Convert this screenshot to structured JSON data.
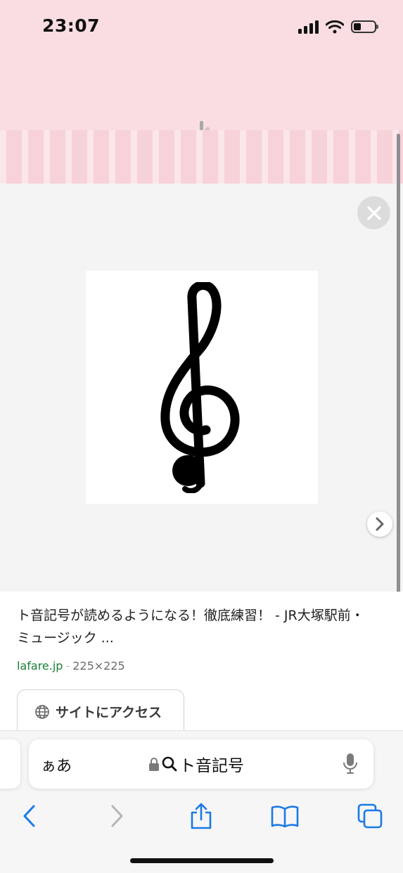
{
  "status_bar": {
    "time": "23:07",
    "signal_icon": "cellular-signal-icon",
    "wifi_icon": "wifi-icon",
    "battery_icon": "battery-icon",
    "battery_level": 0.35
  },
  "viewer": {
    "close_icon": "close-icon",
    "image_icon": "treble-clef-icon",
    "next_icon": "chevron-right-icon"
  },
  "result": {
    "title": "ト音記号が読めるようになる！徹底練習！ - JR大塚駅前・ミュージック ...",
    "domain": "lafare.jp",
    "separator": "-",
    "dimensions": "225×225",
    "visit_button_label": "サイトにアクセス",
    "visit_icon": "globe-icon"
  },
  "address_bar": {
    "aa_label": "ぁあ",
    "lock_icon": "lock-icon",
    "search_icon": "search-icon",
    "query": "ト音記号",
    "mic_icon": "microphone-icon"
  },
  "toolbar": {
    "back_icon": "back-icon",
    "forward_icon": "forward-icon",
    "share_icon": "share-icon",
    "bookmarks_icon": "bookmarks-icon",
    "tabs_icon": "tabs-icon"
  },
  "colors": {
    "header_pink": "#fadde2",
    "link_green": "#1a7f37",
    "ios_blue": "#1a7ae6"
  }
}
